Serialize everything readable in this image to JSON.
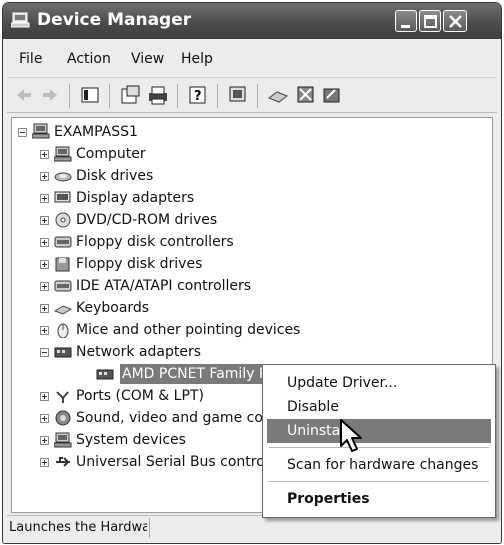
{
  "window": {
    "title": "Device Manager"
  },
  "menu": [
    "File",
    "Action",
    "View",
    "Help"
  ],
  "tree": {
    "root": "EXAMPASS1",
    "items": [
      {
        "label": "Computer",
        "icon": "computer-icon"
      },
      {
        "label": "Disk drives",
        "icon": "disk-icon"
      },
      {
        "label": "Display adapters",
        "icon": "display-icon"
      },
      {
        "label": "DVD/CD-ROM drives",
        "icon": "cdrom-icon"
      },
      {
        "label": "Floppy disk controllers",
        "icon": "controller-icon"
      },
      {
        "label": "Floppy disk drives",
        "icon": "floppy-icon"
      },
      {
        "label": "IDE ATA/ATAPI controllers",
        "icon": "controller-icon"
      },
      {
        "label": "Keyboards",
        "icon": "keyboard-icon"
      },
      {
        "label": "Mice and other pointing devices",
        "icon": "mouse-icon"
      },
      {
        "label": "Network adapters",
        "icon": "network-icon"
      },
      {
        "label": "AMD PCNET Family PCI Ethernet Adapter",
        "icon": "network-icon"
      },
      {
        "label": "Ports (COM & LPT)",
        "icon": "port-icon"
      },
      {
        "label": "Sound, video and game controllers",
        "icon": "sound-icon"
      },
      {
        "label": "System devices",
        "icon": "computer-icon"
      },
      {
        "label": "Universal Serial Bus controllers",
        "icon": "usb-icon"
      }
    ]
  },
  "context_menu": {
    "items": [
      "Update Driver...",
      "Disable",
      "Uninstall",
      "Scan for hardware changes",
      "Properties"
    ],
    "highlighted": "Uninstall"
  },
  "status": {
    "text": "Launches the Hardware Update Wizard"
  }
}
